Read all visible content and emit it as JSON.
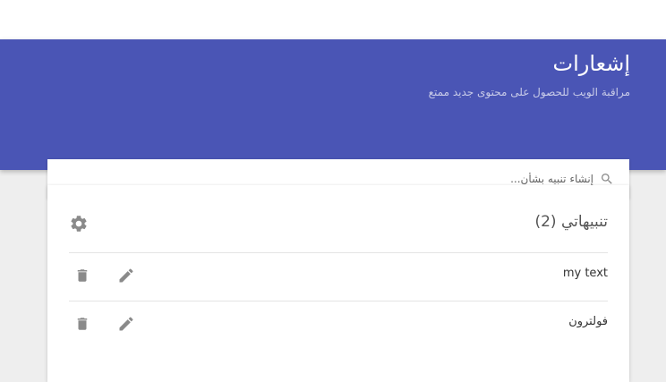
{
  "header": {
    "title": "إشعارات",
    "subtitle": "مراقبة الويب للحصول على محتوى جديد ممتع",
    "color": "#4a55b5"
  },
  "search": {
    "placeholder": "إنشاء تنبيه بشأن...",
    "value": "",
    "icon": "search-icon"
  },
  "alerts": {
    "title": "تنبيهاتي (2)",
    "settings_icon": "gear-icon",
    "items": [
      {
        "label": "my text",
        "edit_icon": "pencil-icon",
        "delete_icon": "trash-icon"
      },
      {
        "label": "فولترون",
        "edit_icon": "pencil-icon",
        "delete_icon": "trash-icon"
      }
    ]
  }
}
